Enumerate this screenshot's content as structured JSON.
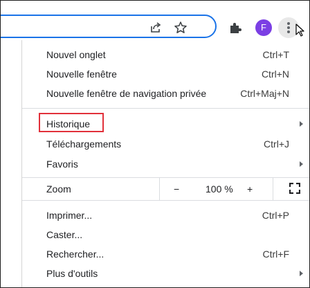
{
  "toolbar": {
    "icons": [
      "share-icon",
      "star-icon",
      "extensions-icon",
      "menu-icon"
    ],
    "avatar_initial": "F",
    "avatar_color": "#7b3fe4",
    "accent_color": "#1a73e8"
  },
  "menu": {
    "group1": [
      {
        "label": "Nouvel onglet",
        "shortcut": "Ctrl+T"
      },
      {
        "label": "Nouvelle fenêtre",
        "shortcut": "Ctrl+N"
      },
      {
        "label": "Nouvelle fenêtre de navigation privée",
        "shortcut": "Ctrl+Maj+N"
      }
    ],
    "group2": [
      {
        "label": "Historique",
        "shortcut": ""
      },
      {
        "label": "Téléchargements",
        "shortcut": "Ctrl+J"
      },
      {
        "label": "Favoris",
        "shortcut": ""
      }
    ],
    "zoom": {
      "label": "Zoom",
      "minus": "−",
      "value": "100 %",
      "plus": "+"
    },
    "group3": [
      {
        "label": "Imprimer...",
        "shortcut": "Ctrl+P"
      },
      {
        "label": "Caster...",
        "shortcut": ""
      },
      {
        "label": "Rechercher...",
        "shortcut": "Ctrl+F"
      },
      {
        "label": "Plus d'outils",
        "shortcut": ""
      }
    ],
    "highlight_color": "#e1303a"
  }
}
